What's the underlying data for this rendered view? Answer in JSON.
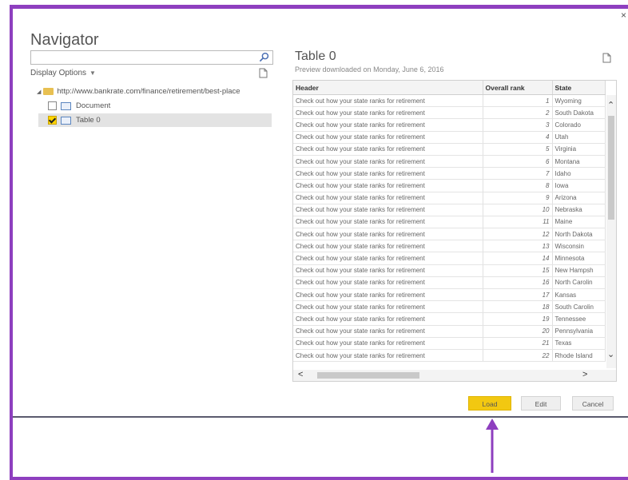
{
  "dialog": {
    "title": "Navigator",
    "close_glyph": "×"
  },
  "left": {
    "search": {
      "value": "",
      "placeholder": ""
    },
    "display_options": "Display Options",
    "tree": {
      "root_label": "http://www.bankrate.com/finance/retirement/best-place",
      "document_label": "Document",
      "table_label": "Table 0"
    }
  },
  "preview": {
    "title": "Table 0",
    "subtitle": "Preview downloaded on Monday, June 6, 2016",
    "columns": [
      "Header",
      "Overall rank",
      "State"
    ],
    "rows": [
      [
        "Check out how your state ranks for retirement",
        "1",
        "Wyoming"
      ],
      [
        "Check out how your state ranks for retirement",
        "2",
        "South Dakota"
      ],
      [
        "Check out how your state ranks for retirement",
        "3",
        "Colorado"
      ],
      [
        "Check out how your state ranks for retirement",
        "4",
        "Utah"
      ],
      [
        "Check out how your state ranks for retirement",
        "5",
        "Virginia"
      ],
      [
        "Check out how your state ranks for retirement",
        "6",
        "Montana"
      ],
      [
        "Check out how your state ranks for retirement",
        "7",
        "Idaho"
      ],
      [
        "Check out how your state ranks for retirement",
        "8",
        "Iowa"
      ],
      [
        "Check out how your state ranks for retirement",
        "9",
        "Arizona"
      ],
      [
        "Check out how your state ranks for retirement",
        "10",
        "Nebraska"
      ],
      [
        "Check out how your state ranks for retirement",
        "11",
        "Maine"
      ],
      [
        "Check out how your state ranks for retirement",
        "12",
        "North Dakota"
      ],
      [
        "Check out how your state ranks for retirement",
        "13",
        "Wisconsin"
      ],
      [
        "Check out how your state ranks for retirement",
        "14",
        "Minnesota"
      ],
      [
        "Check out how your state ranks for retirement",
        "15",
        "New Hampsh"
      ],
      [
        "Check out how your state ranks for retirement",
        "16",
        "North Carolin"
      ],
      [
        "Check out how your state ranks for retirement",
        "17",
        "Kansas"
      ],
      [
        "Check out how your state ranks for retirement",
        "18",
        "South Carolin"
      ],
      [
        "Check out how your state ranks for retirement",
        "19",
        "Tennessee"
      ],
      [
        "Check out how your state ranks for retirement",
        "20",
        "Pennsylvania"
      ],
      [
        "Check out how your state ranks for retirement",
        "21",
        "Texas"
      ],
      [
        "Check out how your state ranks for retirement",
        "22",
        "Rhode Island"
      ]
    ]
  },
  "buttons": {
    "load": "Load",
    "edit": "Edit",
    "cancel": "Cancel"
  },
  "colors": {
    "frame": "#8e3fbf",
    "load_button": "#f2c811",
    "arrow": "#8e3fbf"
  },
  "icons": [
    "search-icon",
    "chevron-down-icon",
    "new-page-icon",
    "folder-icon",
    "table-icon",
    "checkbox-icon",
    "scroll-arrows"
  ]
}
